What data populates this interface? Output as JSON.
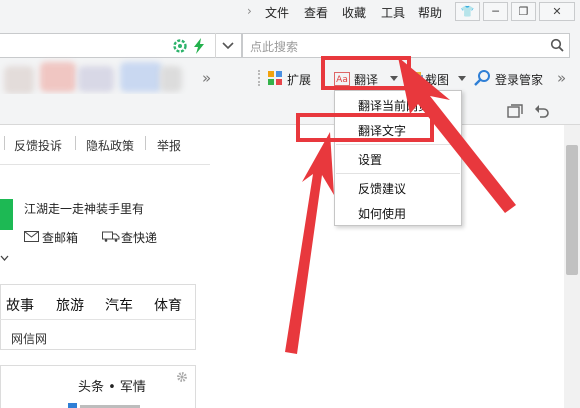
{
  "title_menu": [
    "文件",
    "查看",
    "收藏",
    "工具",
    "帮助"
  ],
  "search": {
    "placeholder": "点此搜索"
  },
  "toolbar": {
    "extensions_label": "扩展",
    "translate_label": "翻译",
    "screenshot_label": "截图",
    "login_manager_label": "登录管家"
  },
  "translate_menu": {
    "items": [
      "翻译当前网页",
      "翻译文字",
      "设置",
      "反馈建议",
      "如何使用"
    ]
  },
  "page": {
    "nav_links": [
      "反馈投诉",
      "隐私政策",
      "举报"
    ],
    "slogan": "江湖走一走神装手里有",
    "mail_link": "查邮箱",
    "express_link": "查快递",
    "categories": [
      "故事",
      "旅游",
      "汽车",
      "体育"
    ],
    "site_link": "网信网",
    "news_tabs": "头条 • 军情"
  },
  "colors": {
    "annotation_red": "#e8383d",
    "green_accent": "#1db954",
    "icon_blue": "#2f7fd6"
  }
}
